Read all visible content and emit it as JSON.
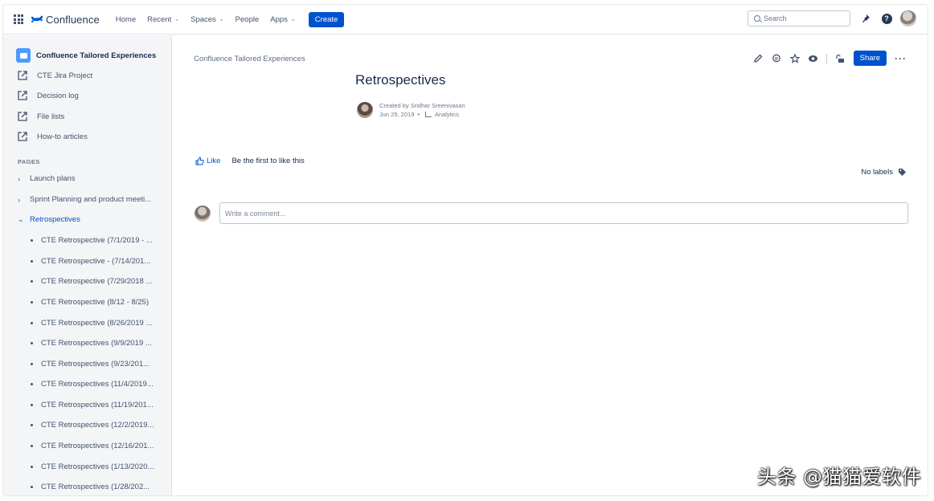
{
  "app": {
    "name": "Confluence",
    "colors": {
      "primary": "#0052cc",
      "text": "#172b4d",
      "sidebar_bg": "#f4f5f7",
      "space_icon": "#4c9aff"
    }
  },
  "topnav": {
    "icons": [
      "app-switcher-icon",
      "confluence-logo-icon"
    ],
    "items": [
      {
        "label": "Home",
        "dropdown": false
      },
      {
        "label": "Recent",
        "dropdown": true
      },
      {
        "label": "Spaces",
        "dropdown": true
      },
      {
        "label": "People",
        "dropdown": false
      },
      {
        "label": "Apps",
        "dropdown": true
      }
    ],
    "create_label": "Create",
    "search_placeholder": "Search",
    "right_icons": [
      "notification-pin-icon",
      "help-icon",
      "profile-avatar"
    ]
  },
  "sidebar": {
    "space_name": "Confluence Tailored Experiences",
    "shortcuts": [
      {
        "label": "CTE Jira Project"
      },
      {
        "label": "Decision log"
      },
      {
        "label": "File lists"
      },
      {
        "label": "How-to articles"
      }
    ],
    "pages_heading": "PAGES",
    "pages": [
      {
        "label": "Launch plans",
        "expanded": false
      },
      {
        "label": "Sprint Planning and product meeti...",
        "expanded": false
      },
      {
        "label": "Retrospectives",
        "expanded": true
      }
    ],
    "children": [
      "CTE Retrospective (7/1/2019 - ...",
      "CTE Retrospective - (7/14/201...",
      "CTE Retrospective (7/29/2018 ...",
      "CTE Retrospective (8/12 - 8/25)",
      "CTE Retrospective (8/26/2019 ...",
      "CTE Retrospectives (9/9/2019 ...",
      "CTE Retrospectives (9/23/201...",
      "CTE Retrospectives (11/4/2019...",
      "CTE Retrospectives (11/19/201...",
      "CTE Retrospectives (12/2/2019...",
      "CTE Retrospectives (12/16/201...",
      "CTE Retrospectives (1/13/2020...",
      "CTE Retrospectives (1/28/202..."
    ]
  },
  "page": {
    "breadcrumb": "Confluence Tailored Experiences",
    "title": "Retrospectives",
    "created_by": "Created by Sridhar Sreenivasan",
    "date": "Jun 25, 2019",
    "bullet": "•",
    "analytics_label": "Analytics",
    "toolbar_icons": [
      "edit-icon",
      "comment-icon",
      "star-icon",
      "watch-icon",
      "restrictions-icon"
    ],
    "share_label": "Share",
    "more_label": "···",
    "like_label": "Like",
    "like_note": "Be the first to like this",
    "labels_text": "No labels",
    "comment_placeholder": "Write a comment..."
  },
  "watermark": "头条 @猫猫爱软件"
}
